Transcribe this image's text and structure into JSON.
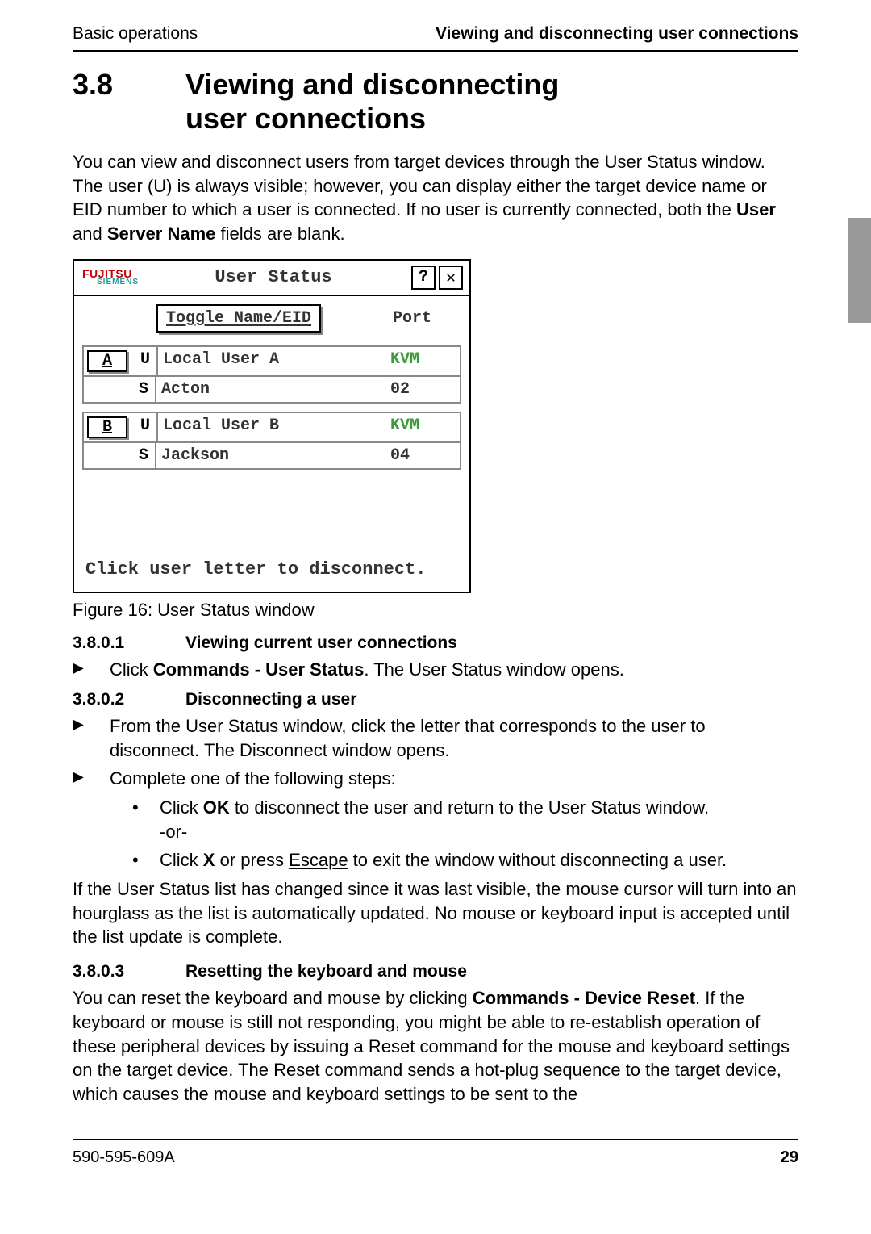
{
  "header": {
    "left": "Basic operations",
    "right": "Viewing and disconnecting user connections"
  },
  "section": {
    "number": "3.8",
    "title_line1": "Viewing and disconnecting",
    "title_line2": "user connections"
  },
  "intro": {
    "p1a": "You can view and disconnect users from target devices through the User Status window. The user (U) is always visible; however, you can display either the target device name or EID number to which a user is connected. If no user is currently connected, both the ",
    "bold1": "User",
    "p1b": " and ",
    "bold2": "Server Name",
    "p1c": " fields are blank."
  },
  "window": {
    "logo_top": "FUJITSU",
    "logo_bottom": "SIEMENS",
    "title": "User Status",
    "help_icon": "?",
    "close_icon": "✕",
    "toggle_label": "Toggle Name/EID",
    "port_header": "Port",
    "entries": [
      {
        "letter": "A",
        "u_row_type": "U",
        "u_row_name": "Local User A",
        "u_row_port": "KVM",
        "s_row_type": "S",
        "s_row_name": "Acton",
        "s_row_port": "02"
      },
      {
        "letter": "B",
        "u_row_type": "U",
        "u_row_name": "Local User B",
        "u_row_port": "KVM",
        "s_row_type": "S",
        "s_row_name": "Jackson",
        "s_row_port": "04"
      }
    ],
    "hint": "Click user letter to disconnect."
  },
  "figure_caption": "Figure 16: User Status window",
  "sub1": {
    "num": "3.8.0.1",
    "title": "Viewing current user connections",
    "b1a": "Click ",
    "b1bold": "Commands - User Status",
    "b1b": ". The User Status window opens."
  },
  "sub2": {
    "num": "3.8.0.2",
    "title": "Disconnecting a user",
    "b1": "From the User Status window, click the letter that corresponds to the user to disconnect. The Disconnect window opens.",
    "b2": "Complete one of the following steps:",
    "d1a": "Click ",
    "d1bold": "OK",
    "d1b": " to disconnect the user and return to the User Status window.",
    "d1or": "-or-",
    "d2a": "Click ",
    "d2bold": "X",
    "d2b": " or press ",
    "d2u": "Escape",
    "d2c": " to exit the window without disconnecting a user.",
    "para": "If the User Status list has changed since it was last visible, the mouse cursor will turn into an hourglass as the list is automatically updated. No mouse or keyboard input is accepted until the list update is complete."
  },
  "sub3": {
    "num": "3.8.0.3",
    "title": "Resetting the keyboard and mouse",
    "p_a": "You can reset the keyboard and mouse by clicking ",
    "p_bold": "Commands - Device Reset",
    "p_b": ". If the keyboard or mouse is still not responding, you might be able to re-establish operation of these peripheral devices by issuing a Reset command for the mouse and keyboard settings on the target device. The Reset command sends a hot-plug sequence to the target device, which causes the mouse and keyboard settings to be sent to the"
  },
  "footer": {
    "left": "590-595-609A",
    "right": "29"
  }
}
